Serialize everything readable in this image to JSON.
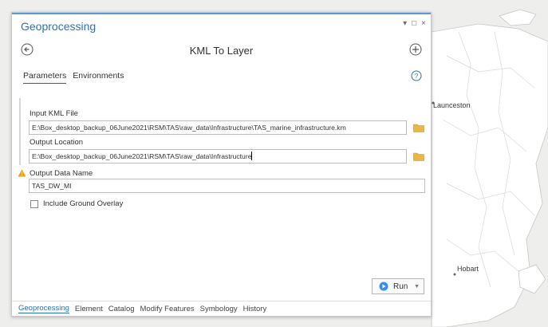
{
  "pane": {
    "title": "Geoprocessing",
    "window_controls": {
      "pin_label": "▾",
      "maximize_label": "□",
      "close_label": "×"
    },
    "tool_title": "KML To Layer",
    "tabs": [
      {
        "label": "Parameters",
        "active": true
      },
      {
        "label": "Environments",
        "active": false
      }
    ]
  },
  "parameters": {
    "input_kml": {
      "label": "Input KML File",
      "value": "E:\\Box_desktop_backup_06June2021\\RSM\\TAS\\raw_data\\Infrastructure\\TAS_marine_infrastructure.km"
    },
    "output_location": {
      "label": "Output Location",
      "value": "E:\\Box_desktop_backup_06June2021\\RSM\\TAS\\raw_data\\Infrastructure"
    },
    "output_name": {
      "label": "Output Data Name",
      "value": "TAS_DW_MI"
    },
    "include_ground_overlay": {
      "label": "Include Ground Overlay",
      "checked": false
    }
  },
  "run_button": {
    "label": "Run"
  },
  "bottom_tabs": [
    {
      "label": "Geoprocessing",
      "active": true
    },
    {
      "label": "Element",
      "active": false
    },
    {
      "label": "Catalog",
      "active": false
    },
    {
      "label": "Modify Features",
      "active": false
    },
    {
      "label": "Symbology",
      "active": false
    },
    {
      "label": "History",
      "active": false
    }
  ],
  "map": {
    "labels": {
      "launceston": "Launceston",
      "hobart": "Hobart"
    }
  },
  "colors": {
    "accent": "#2b73b8",
    "warning": "#e8a317",
    "folder": "#e9b64a",
    "run": "#3a8ee6",
    "land": "#ffffff",
    "water": "#f0f0ee"
  },
  "icons": {
    "back": "back-arrow-icon",
    "add": "add-icon",
    "help": "help-icon",
    "folder": "folder-icon",
    "warning": "warning-icon",
    "run": "run-icon"
  }
}
